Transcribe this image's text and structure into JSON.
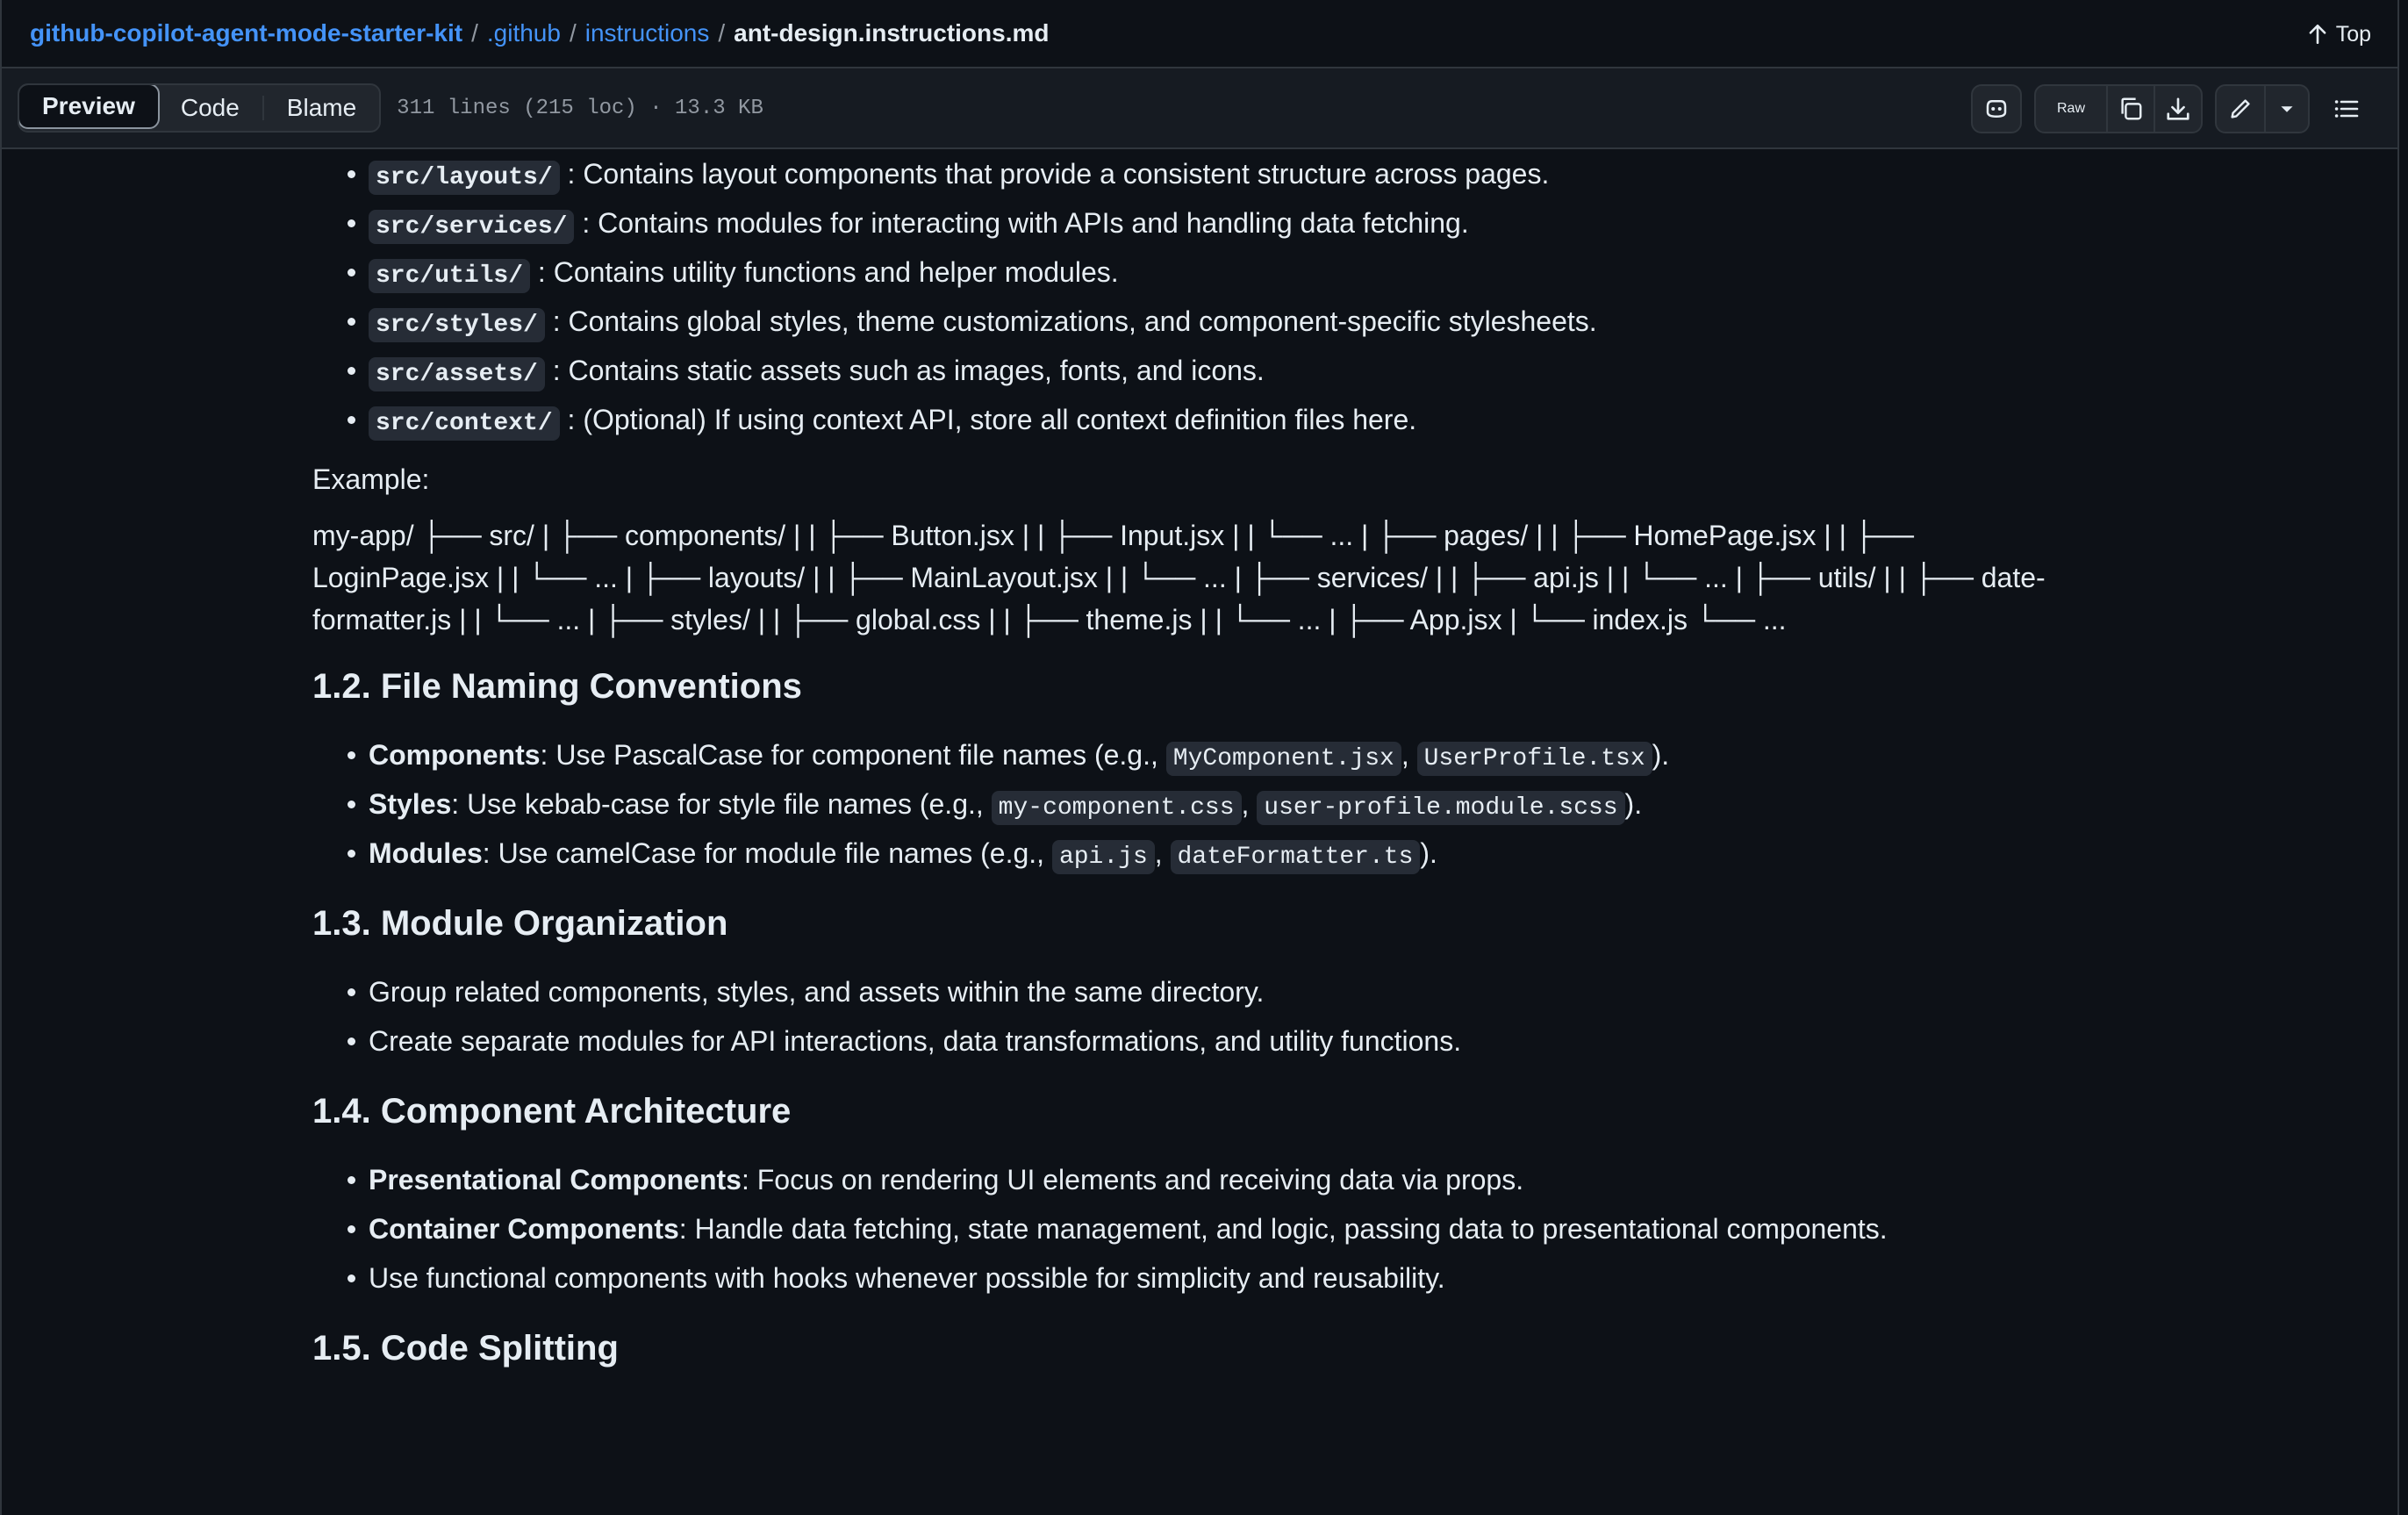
{
  "breadcrumb": {
    "repo": "github-copilot-agent-mode-starter-kit",
    "sep": "/",
    "folder1": ".github",
    "folder2": "instructions",
    "file": "ant-design.instructions.md",
    "top_label": "Top"
  },
  "toolbar": {
    "tabs": [
      "Preview",
      "Code",
      "Blame"
    ],
    "file_info": "311 lines (215 loc) · 13.3 KB",
    "raw_label": "Raw"
  },
  "dirs": [
    {
      "code": "src/layouts/",
      "text": ": Contains layout components that provide a consistent structure across pages."
    },
    {
      "code": "src/services/",
      "text": ": Contains modules for interacting with APIs and handling data fetching."
    },
    {
      "code": "src/utils/",
      "text": ": Contains utility functions and helper modules."
    },
    {
      "code": "src/styles/",
      "text": ": Contains global styles, theme customizations, and component-specific stylesheets."
    },
    {
      "code": "src/assets/",
      "text": ": Contains static assets such as images, fonts, and icons."
    },
    {
      "code": "src/context/",
      "text": ": (Optional) If using context API, store all context definition files here."
    }
  ],
  "example_label": "Example:",
  "tree_text": "my-app/ ├── src/ | ├── components/ | | ├── Button.jsx | | ├── Input.jsx | | └── ... | ├── pages/ | | ├── HomePage.jsx | | ├── LoginPage.jsx | | └── ... | ├── layouts/ | | ├── MainLayout.jsx | | └── ... | ├── services/ | | ├── api.js | | └── ... | ├── utils/ | | ├── date-formatter.js | | └── ... | ├── styles/ | | ├── global.css | | ├── theme.js | | └── ... | ├── App.jsx | └── index.js └── ...",
  "section_12": {
    "heading": "1.2. File Naming Conventions",
    "items": [
      {
        "bold": "Components",
        "text": ": Use PascalCase for component file names (e.g., ",
        "code1": "MyComponent.jsx",
        "mid": ", ",
        "code2": "UserProfile.tsx",
        "end": ")."
      },
      {
        "bold": "Styles",
        "text": ": Use kebab-case for style file names (e.g., ",
        "code1": "my-component.css",
        "mid": ", ",
        "code2": "user-profile.module.scss",
        "end": ")."
      },
      {
        "bold": "Modules",
        "text": ": Use camelCase for module file names (e.g., ",
        "code1": "api.js",
        "mid": ", ",
        "code2": "dateFormatter.ts",
        "end": ")."
      }
    ]
  },
  "section_13": {
    "heading": "1.3. Module Organization",
    "items": [
      "Group related components, styles, and assets within the same directory.",
      "Create separate modules for API interactions, data transformations, and utility functions."
    ]
  },
  "section_14": {
    "heading": "1.4. Component Architecture",
    "items": [
      {
        "bold": "Presentational Components",
        "text": ": Focus on rendering UI elements and receiving data via props."
      },
      {
        "bold": "Container Components",
        "text": ": Handle data fetching, state management, and logic, passing data to presentational components."
      },
      {
        "bold": "",
        "text": "Use functional components with hooks whenever possible for simplicity and reusability."
      }
    ]
  },
  "section_15": {
    "heading": "1.5. Code Splitting"
  },
  "icons": [
    "arrow-up-icon",
    "copilot-icon",
    "copy-icon",
    "download-icon",
    "pencil-icon",
    "triangle-down-icon",
    "list-icon"
  ]
}
